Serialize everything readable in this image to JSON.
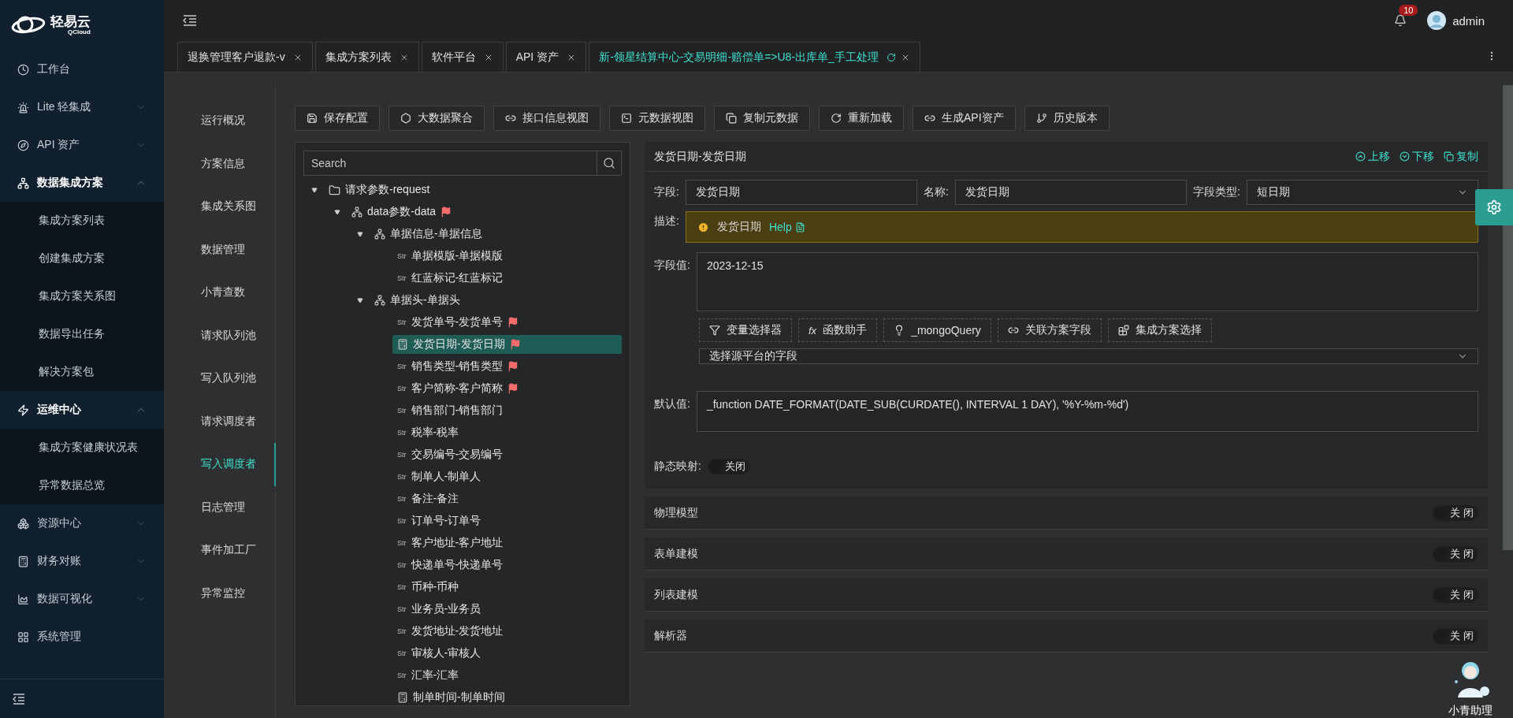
{
  "brand": {
    "name": "轻易云",
    "sub": "QCloud"
  },
  "sidebar": {
    "items": [
      {
        "label": "工作台",
        "kind": "link"
      },
      {
        "label": "Lite 轻集成",
        "kind": "group",
        "expanded": false
      },
      {
        "label": "API 资产",
        "kind": "group",
        "expanded": false
      },
      {
        "label": "数据集成方案",
        "kind": "group",
        "expanded": true,
        "children": [
          {
            "label": "集成方案列表"
          },
          {
            "label": "创建集成方案"
          },
          {
            "label": "集成方案关系图"
          },
          {
            "label": "数据导出任务"
          },
          {
            "label": "解决方案包"
          }
        ]
      },
      {
        "label": "运维中心",
        "kind": "group",
        "expanded": true,
        "children": [
          {
            "label": "集成方案健康状况表"
          },
          {
            "label": "异常数据总览"
          }
        ]
      },
      {
        "label": "资源中心",
        "kind": "group",
        "expanded": false
      },
      {
        "label": "财务对账",
        "kind": "group",
        "expanded": false
      },
      {
        "label": "数据可视化",
        "kind": "group",
        "expanded": false
      },
      {
        "label": "系统管理",
        "kind": "link"
      }
    ]
  },
  "header": {
    "notifications": "10",
    "user": "admin"
  },
  "tabs": [
    {
      "label": "退换管理客户退款-v",
      "selected": false,
      "refresh": false
    },
    {
      "label": "集成方案列表",
      "selected": false,
      "refresh": false
    },
    {
      "label": "软件平台",
      "selected": false,
      "refresh": false
    },
    {
      "label": "API 资产",
      "selected": false,
      "refresh": false
    },
    {
      "label": "新-领星结算中心-交易明细-赔偿单=>U8-出库单_手工处理",
      "selected": true,
      "refresh": true
    }
  ],
  "section_nav": [
    {
      "label": "运行概况",
      "selected": false
    },
    {
      "label": "方案信息",
      "selected": false
    },
    {
      "label": "集成关系图",
      "selected": false
    },
    {
      "label": "数据管理",
      "selected": false
    },
    {
      "label": "小青查数",
      "selected": false
    },
    {
      "label": "请求队列池",
      "selected": false
    },
    {
      "label": "写入队列池",
      "selected": false
    },
    {
      "label": "请求调度者",
      "selected": false
    },
    {
      "label": "写入调度者",
      "selected": true
    },
    {
      "label": "日志管理",
      "selected": false
    },
    {
      "label": "事件加工厂",
      "selected": false
    },
    {
      "label": "异常监控",
      "selected": false
    }
  ],
  "toolbar": [
    {
      "label": "保存配置"
    },
    {
      "label": "大数据聚合"
    },
    {
      "label": "接口信息视图"
    },
    {
      "label": "元数据视图"
    },
    {
      "label": "复制元数据"
    },
    {
      "label": "重新加载"
    },
    {
      "label": "生成API资产"
    },
    {
      "label": "历史版本"
    }
  ],
  "tree": {
    "search_placeholder": "Search",
    "nodes": [
      {
        "label": "请求参数-request",
        "kind": "folder",
        "expanded": true,
        "flagged": false,
        "selected": false,
        "children": [
          {
            "label": "data参数-data",
            "kind": "object",
            "expanded": true,
            "flagged": true,
            "selected": false,
            "children": [
              {
                "label": "单据信息-单据信息",
                "kind": "object",
                "expanded": true,
                "flagged": false,
                "selected": false,
                "children": [
                  {
                    "label": "单据模版-单据模版",
                    "kind": "str",
                    "tag": "Str",
                    "flagged": false,
                    "selected": false
                  },
                  {
                    "label": "红蓝标记-红蓝标记",
                    "kind": "str",
                    "tag": "Str",
                    "flagged": false,
                    "selected": false
                  }
                ]
              },
              {
                "label": "单据头-单据头",
                "kind": "object",
                "expanded": true,
                "flagged": false,
                "selected": false,
                "children": [
                  {
                    "label": "发货单号-发货单号",
                    "kind": "str",
                    "tag": "Str",
                    "flagged": true,
                    "selected": false
                  },
                  {
                    "label": "发货日期-发货日期",
                    "kind": "date",
                    "flagged": true,
                    "selected": true
                  },
                  {
                    "label": "销售类型-销售类型",
                    "kind": "str",
                    "tag": "Str",
                    "flagged": true,
                    "selected": false
                  },
                  {
                    "label": "客户简称-客户简称",
                    "kind": "str",
                    "tag": "Str",
                    "flagged": true,
                    "selected": false
                  },
                  {
                    "label": "销售部门-销售部门",
                    "kind": "str",
                    "tag": "Str",
                    "flagged": false,
                    "selected": false
                  },
                  {
                    "label": "税率-税率",
                    "kind": "str",
                    "tag": "Str",
                    "flagged": false,
                    "selected": false
                  },
                  {
                    "label": "交易编号-交易编号",
                    "kind": "str",
                    "tag": "Str",
                    "flagged": false,
                    "selected": false
                  },
                  {
                    "label": "制单人-制单人",
                    "kind": "str",
                    "tag": "Str",
                    "flagged": false,
                    "selected": false
                  },
                  {
                    "label": "备注-备注",
                    "kind": "str",
                    "tag": "Str",
                    "flagged": false,
                    "selected": false
                  },
                  {
                    "label": "订单号-订单号",
                    "kind": "str",
                    "tag": "Str",
                    "flagged": false,
                    "selected": false
                  },
                  {
                    "label": "客户地址-客户地址",
                    "kind": "str",
                    "tag": "Str",
                    "flagged": false,
                    "selected": false
                  },
                  {
                    "label": "快递单号-快递单号",
                    "kind": "str",
                    "tag": "Str",
                    "flagged": false,
                    "selected": false
                  },
                  {
                    "label": "币种-币种",
                    "kind": "str",
                    "tag": "Str",
                    "flagged": false,
                    "selected": false
                  },
                  {
                    "label": "业务员-业务员",
                    "kind": "str",
                    "tag": "Str",
                    "flagged": false,
                    "selected": false
                  },
                  {
                    "label": "发货地址-发货地址",
                    "kind": "str",
                    "tag": "Str",
                    "flagged": false,
                    "selected": false
                  },
                  {
                    "label": "审核人-审核人",
                    "kind": "str",
                    "tag": "Str",
                    "flagged": false,
                    "selected": false
                  },
                  {
                    "label": "汇率-汇率",
                    "kind": "str",
                    "tag": "Str",
                    "flagged": false,
                    "selected": false
                  },
                  {
                    "label": "制单时间-制单时间",
                    "kind": "date",
                    "flagged": false,
                    "selected": false
                  }
                ]
              }
            ]
          }
        ]
      }
    ]
  },
  "detail": {
    "title": "发货日期-发货日期",
    "actions": [
      {
        "label": "上移"
      },
      {
        "label": "下移"
      },
      {
        "label": "复制"
      }
    ],
    "field_label": "字段:",
    "field_value": "发货日期",
    "name_label": "名称:",
    "name_value": "发货日期",
    "type_label": "字段类型:",
    "type_value": "短日期",
    "desc_label": "描述:",
    "desc_text": "发货日期",
    "help": "Help",
    "value_label": "字段值:",
    "value": "2023-12-15",
    "helpers": [
      {
        "label": "变量选择器"
      },
      {
        "label": "函数助手",
        "glyph": "fx"
      },
      {
        "label": "_mongoQuery"
      },
      {
        "label": "关联方案字段"
      },
      {
        "label": "集成方案选择"
      }
    ],
    "source_placeholder": "选择源平台的字段",
    "default_label": "默认值:",
    "default_value": "_function DATE_FORMAT(DATE_SUB(CURDATE(), INTERVAL 1 DAY), '%Y-%m-%d')",
    "mapping_label": "静态映射:",
    "mapping": {
      "on": false,
      "label": "关闭"
    }
  },
  "sections": [
    {
      "title": "物理模型",
      "on": false,
      "label": "关 闭"
    },
    {
      "title": "表单建模",
      "on": false,
      "label": "关 闭"
    },
    {
      "title": "列表建模",
      "on": false,
      "label": "关 闭"
    },
    {
      "title": "解析器",
      "on": false,
      "label": "关 闭"
    }
  ],
  "assistant": {
    "label": "小青助理"
  }
}
